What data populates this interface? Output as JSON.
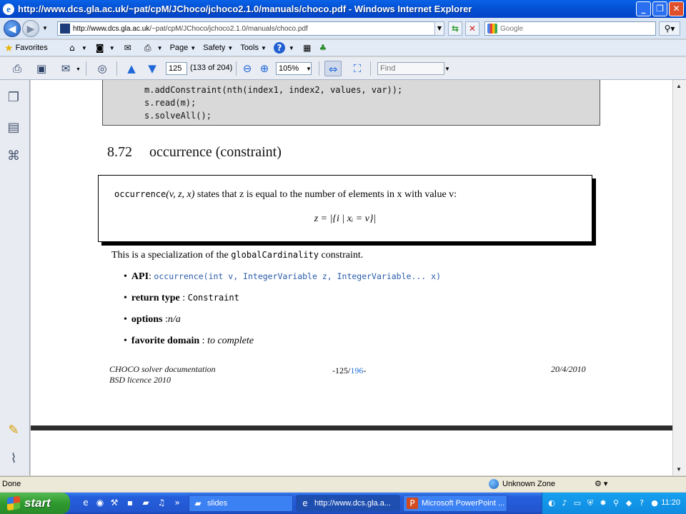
{
  "window": {
    "title": "http://www.dcs.gla.ac.uk/~pat/cpM/JChoco/jchoco2.1.0/manuals/choco.pdf - Windows Internet Explorer",
    "minimize": "_",
    "maximize": "❐",
    "close": "✕"
  },
  "address": {
    "url_host": "http://www.dcs.gla.ac.uk",
    "url_path": "/~pat/cpM/JChoco/jchoco2.1.0/manuals/choco.pdf",
    "search_placeholder": "Google"
  },
  "commandbar": {
    "favorites": "Favorites",
    "page": "Page",
    "safety": "Safety",
    "tools": "Tools"
  },
  "pdf_toolbar": {
    "page_number": "125",
    "page_count": "(133 of 204)",
    "zoom": "105%",
    "find_placeholder": "Find"
  },
  "document": {
    "code_lines": [
      "m.addConstraint(nth(index1, index2, values, var));",
      "s.read(m);",
      "s.solveAll();"
    ],
    "section_number": "8.72",
    "section_title": "occurrence (constraint)",
    "definition": {
      "func": "occurrence",
      "args": "(v, z, x)",
      "text": " states that z is equal to the number of elements in x with value v:",
      "formula": "z = |{i | xᵢ = v}|"
    },
    "intro_before": "This is a specialization of the ",
    "intro_code": "globalCardinality",
    "intro_after": " constraint.",
    "bullets": {
      "api_label": "API",
      "api_value": "occurrence(int v, IntegerVariable z, IntegerVariable... x)",
      "return_label": "return type",
      "return_value": "Constraint",
      "options_label": "options",
      "options_value": "n/a",
      "domain_label": "favorite domain",
      "domain_value": "to complete"
    },
    "footer": {
      "left_line1": "CHOCO solver documentation",
      "left_line2": "BSD licence 2010",
      "page_current": "-125/",
      "page_total": "196",
      "page_end": "-",
      "date": "20/4/2010"
    }
  },
  "statusbar": {
    "status": "Done",
    "zone": "Unknown Zone"
  },
  "taskbar": {
    "start": "start",
    "tasks": [
      "slides",
      "http://www.dcs.gla.a...",
      "Microsoft PowerPoint ..."
    ],
    "clock": "11:20"
  }
}
